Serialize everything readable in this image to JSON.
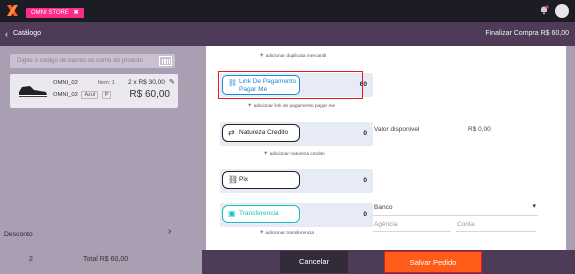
{
  "app": {
    "tab_label": "OMNI STORE",
    "tab_close": "✖",
    "colors": {
      "top_bg": "#1c1c24",
      "purple_header": "#4d3b58",
      "pane": "#a99eb2",
      "pink": "#ff2b8a",
      "accent": "#18c2c2",
      "save": "#ff5c1a"
    }
  },
  "header": {
    "back_icon": "chevron-left",
    "title": "Catálogo",
    "right_text": "Finalizar Compra  R$ 60,00"
  },
  "catalog": {
    "search_placeholder": "Digite o código de barras ou nome do produto",
    "items": [
      {
        "name": "OMNI_02",
        "line": "Item: 1",
        "qty_price": "2 x R$ 30,00",
        "code": "OMNI_02",
        "color": "Azul",
        "size": "P",
        "total": "R$ 60,00"
      }
    ],
    "desconto_label": "Desconto",
    "desconto_chevron": "›",
    "item_count": "2",
    "total_label": "Total R$ 60,00"
  },
  "payment": {
    "add_duplicata": "adicionar duplicata mercantil",
    "link_pagamento": {
      "label": "Link De Pagamento Pagar Me",
      "value": "60",
      "add": "adicionar link de pagamento pagar me"
    },
    "natureza": {
      "label": "Natureza Credito",
      "value": "0",
      "add": "adicionar natureza credito"
    },
    "pix": {
      "label": "Pix",
      "value": "0"
    },
    "transferencia": {
      "label": "Transferencia",
      "value": "0",
      "add": "adicionar transferencia"
    },
    "valor_disponivel_label": "Valor disponivel",
    "valor_disponivel_value": "R$ 0,00",
    "banco_label": "Banco",
    "agencia_label": "Agência",
    "conta_label": "Conta"
  },
  "footer": {
    "cancel": "Cancelar",
    "save": "Salvar Pedido"
  }
}
